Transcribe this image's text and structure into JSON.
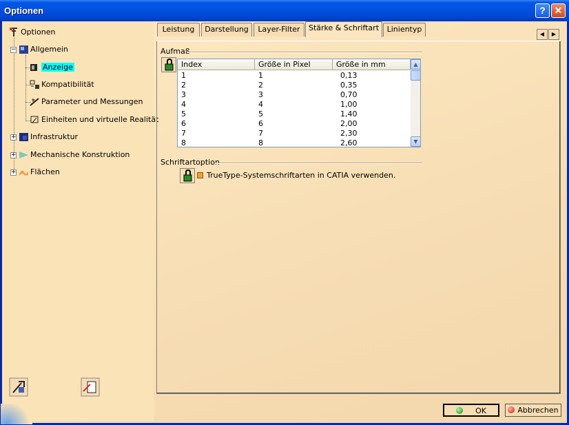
{
  "window": {
    "title": "Optionen"
  },
  "tree": {
    "root": "Optionen",
    "items": [
      {
        "label": "Allgemein"
      },
      {
        "label": "Anzeige"
      },
      {
        "label": "Kompatibilität"
      },
      {
        "label": "Parameter und Messungen"
      },
      {
        "label": "Einheiten und virtuelle Realität"
      },
      {
        "label": "Infrastruktur"
      },
      {
        "label": "Mechanische Konstruktion"
      },
      {
        "label": "Flächen"
      }
    ]
  },
  "tabs": [
    "Leistung",
    "Darstellung",
    "Layer-Filter",
    "Stärke & Schriftart",
    "Linientyp"
  ],
  "active_tab": "Stärke & Schriftart",
  "aufmass": {
    "label": "Aufmaß",
    "headers": [
      "Index",
      "Größe in Pixel",
      "Größe in mm"
    ],
    "rows": [
      [
        "1",
        "1",
        "0,13"
      ],
      [
        "2",
        "2",
        "0,35"
      ],
      [
        "3",
        "3",
        "0,70"
      ],
      [
        "4",
        "4",
        "1,00"
      ],
      [
        "5",
        "5",
        "1,40"
      ],
      [
        "6",
        "6",
        "2,00"
      ],
      [
        "7",
        "7",
        "2,30"
      ],
      [
        "8",
        "8",
        "2,60"
      ]
    ]
  },
  "schriftart": {
    "label": "Schriftartoption",
    "checkbox_label": "TrueType-Systemschriftarten in CATIA verwenden."
  },
  "buttons": {
    "ok": "OK",
    "cancel": "Abbrechen"
  }
}
